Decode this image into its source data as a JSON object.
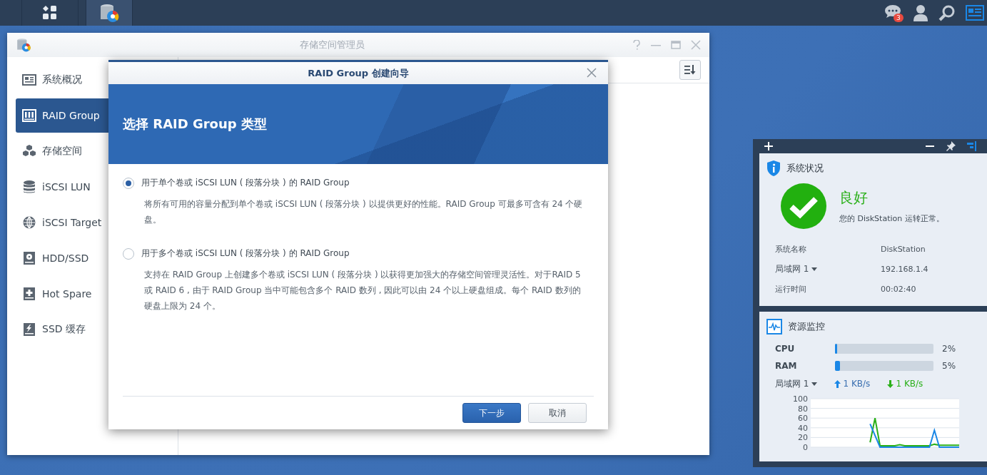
{
  "taskbar": {
    "notification_badge": "3"
  },
  "window": {
    "title": "存储空间管理员"
  },
  "sidebar": {
    "items": [
      {
        "label": "系统概况",
        "selected": false
      },
      {
        "label": "RAID Group",
        "selected": true
      },
      {
        "label": "存储空间",
        "selected": false
      },
      {
        "label": "iSCSI LUN",
        "selected": false
      },
      {
        "label": "iSCSI Target",
        "selected": false
      },
      {
        "label": "HDD/SSD",
        "selected": false
      },
      {
        "label": "Hot Spare",
        "selected": false
      },
      {
        "label": "SSD 缓存",
        "selected": false
      }
    ]
  },
  "dialog": {
    "title": "RAID Group 创建向导",
    "heading": "选择 RAID Group 类型",
    "options": [
      {
        "label": "用于单个卷或 iSCSI LUN ( 段落分块 ) 的 RAID Group",
        "description": "将所有可用的容量分配到单个卷或 iSCSI LUN ( 段落分块 ) 以提供更好的性能。RAID Group 可最多可含有 24 个硬盘。",
        "selected": true
      },
      {
        "label": "用于多个卷或 iSCSI LUN ( 段落分块 ) 的 RAID Group",
        "description": "支持在 RAID Group 上创建多个卷或 iSCSI LUN ( 段落分块 ) 以获得更加强大的存储空间管理灵活性。对于RAID 5 或 RAID 6 , 由于 RAID Group 当中可能包含多个 RAID 数列 , 因此可以由 24 个以上硬盘组成。每个 RAID 数列的硬盘上限为 24 个。",
        "selected": false
      }
    ],
    "buttons": [
      {
        "label": "下一步",
        "kind": "primary"
      },
      {
        "label": "取消",
        "kind": "secondary"
      }
    ]
  },
  "system_status": {
    "title": "系统状况",
    "status": "良好",
    "message": "您的 DiskStation 运转正常。",
    "rows": [
      {
        "label": "系统名称",
        "value": "DiskStation",
        "dropdown": false
      },
      {
        "label": "局域网 1",
        "value": "192.168.1.4",
        "dropdown": true
      },
      {
        "label": "运行时间",
        "value": "00:02:40",
        "dropdown": false
      }
    ]
  },
  "resource_monitor": {
    "title": "资源监控",
    "meters": [
      {
        "label": "CPU",
        "level": 0.02,
        "reading": "2%"
      },
      {
        "label": "RAM",
        "level": 0.05,
        "reading": "5%"
      }
    ],
    "network": {
      "label": "局域网 1",
      "upload": "1 KB/s",
      "download": "1 KB/s"
    },
    "chart_data": {
      "type": "line",
      "grid": true,
      "ylim": [
        0,
        100
      ],
      "yticks": [
        0,
        20,
        40,
        60,
        80,
        100
      ],
      "series": [
        {
          "color": "#1a87e6",
          "values": [
            null,
            null,
            null,
            null,
            null,
            null,
            null,
            null,
            null,
            null,
            null,
            null,
            48,
            24,
            0,
            0,
            0,
            0,
            0,
            0,
            0,
            0,
            0,
            0,
            0,
            35,
            0,
            0,
            0,
            0,
            0
          ]
        },
        {
          "color": "#2bb01a",
          "values": [
            null,
            null,
            null,
            null,
            null,
            null,
            null,
            null,
            null,
            null,
            null,
            null,
            10,
            60,
            3,
            3,
            3,
            3,
            5,
            3,
            3,
            3,
            3,
            3,
            3,
            6,
            4,
            4,
            4,
            4,
            4
          ]
        }
      ]
    }
  }
}
